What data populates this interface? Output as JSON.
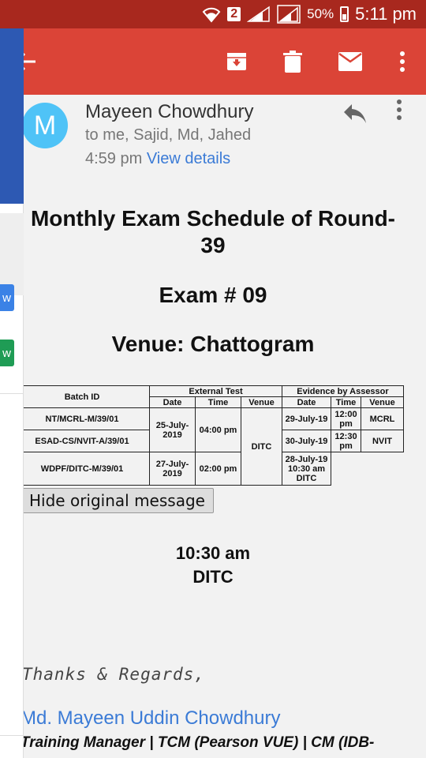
{
  "status_bar": {
    "sim": "2",
    "battery": "50%",
    "time": "5:11 pm"
  },
  "drawer": {
    "chip_blue": "w",
    "chip_green": "w"
  },
  "app_bar": {
    "back_icon": "arrow-left-icon",
    "archive_icon": "archive-icon",
    "delete_icon": "trash-icon",
    "mail_icon": "mail-icon",
    "more_icon": "more-vert-icon"
  },
  "email": {
    "avatar_letter": "M",
    "sender_name": "Mayeen Chowdhury",
    "recipients": "to me, Sajid, Md, Jahed",
    "sent_time": "4:59 pm",
    "view_details": "View details",
    "title": "Monthly Exam Schedule of Round-39",
    "exam_no": "Exam # 09",
    "venue_heading": "Venue: Chattogram",
    "hide_button": "Hide original message",
    "trailing_time": "10:30 am",
    "trailing_venue": "DITC",
    "regards": "Thanks & Regards,",
    "sig_name": "Md. Mayeen Uddin Chowdhury",
    "sig_title": "Training Manager | TCM (Pearson VUE) | CM (IDB-"
  },
  "table": {
    "headers": {
      "batch_id": "Batch ID",
      "external_test": "External Test",
      "evidence": "Evidence by Assessor",
      "date": "Date",
      "time": "Time",
      "venue": "Venue"
    },
    "rows": [
      {
        "batch": "NT/MCRL-M/39/01",
        "ev_date": "29-July-19",
        "ev_time": "12:00 pm",
        "ev_venue": "MCRL"
      },
      {
        "batch": "ESAD-CS/NVIT-A/39/01",
        "ev_date": "30-July-19",
        "ev_time": "12:30 pm",
        "ev_venue": "NVIT"
      },
      {
        "batch": "WDPF/DITC-M/39/01",
        "ev_combined": "28-July-19 10:30 am DITC"
      }
    ],
    "group1_date": "25-July-2019",
    "group1_time": "04:00 pm",
    "shared_venue": "DITC",
    "row3_date": "27-July-2019",
    "row3_time": "02:00 pm"
  }
}
